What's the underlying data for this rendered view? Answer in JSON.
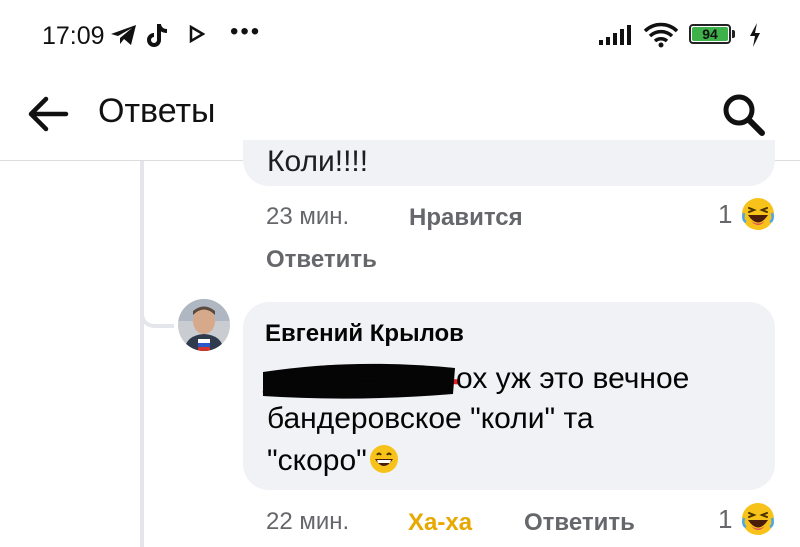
{
  "status_bar": {
    "time": "17:09",
    "battery_level": "94",
    "icons": [
      "telegram-icon",
      "tiktok-icon",
      "play-icon",
      "more-dots",
      "signal-icon",
      "wifi-icon",
      "battery-icon",
      "charging-icon"
    ],
    "overflow_dots": "•••"
  },
  "header": {
    "title": "Ответы",
    "back_icon": "arrow-left-icon",
    "search_icon": "search-icon"
  },
  "previous_comment": {
    "text_fragment": "Коли!!!!",
    "time": "23 мин.",
    "like_label": "Нравится",
    "reply_label": "Ответить",
    "reaction_count": "1",
    "reaction_icon": "laughing-emoji-icon"
  },
  "reply_comment": {
    "author": "Евгений Крылов",
    "text_line1": "ох уж это вечное",
    "text_line2": "бандеровское \"коли\" та",
    "text_line3": "\"скоро\"",
    "time": "22 мин.",
    "haha_label": "Ха-ха",
    "reply_label": "Ответить",
    "reaction_count": "1",
    "reaction_icon": "laughing-emoji-icon"
  },
  "colors": {
    "bubble": "#f0f2f5",
    "meta_text": "#65676b",
    "haha": "#e9a800",
    "battery": "#3fb14a"
  }
}
